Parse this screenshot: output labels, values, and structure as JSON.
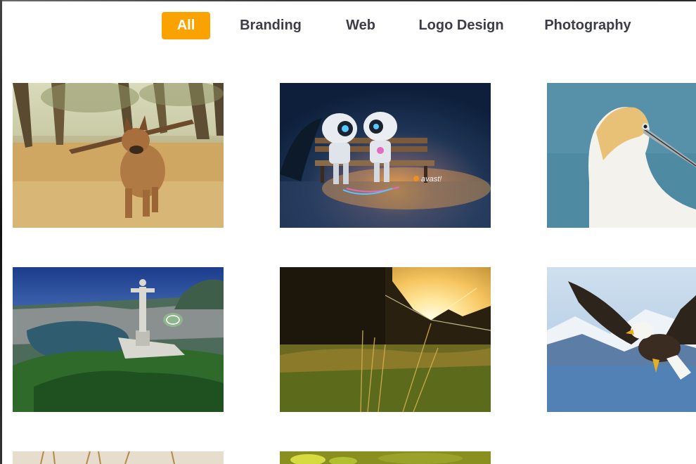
{
  "filters": {
    "all": "All",
    "branding": "Branding",
    "web": "Web",
    "logo_design": "Logo Design",
    "photography": "Photography",
    "active_color": "#f9a200"
  },
  "gallery": {
    "items": [
      {
        "subject": "dog carrying a stick in a field"
      },
      {
        "subject": "two robots on a park bench",
        "logo_text": "avast!"
      },
      {
        "subject": "gannet bird head"
      },
      {
        "subject": "aerial view of Christ the Redeemer statue over Rio de Janeiro"
      },
      {
        "subject": "sunset through grass and forest"
      },
      {
        "subject": "bald eagle in flight over mountains and water"
      },
      {
        "subject": "dry grass stalks (partially visible)"
      },
      {
        "subject": "yellow-green foliage (partially visible)"
      }
    ]
  }
}
